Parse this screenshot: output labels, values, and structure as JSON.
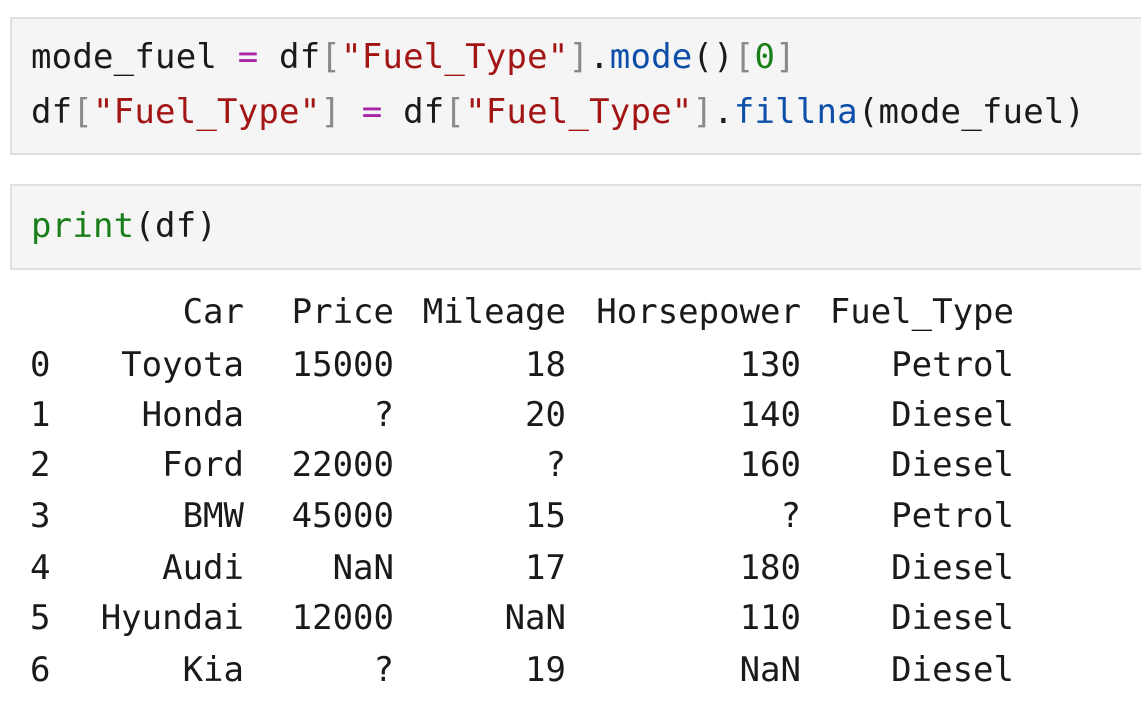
{
  "cells": [
    {
      "lines": [
        [
          {
            "t": "mode_fuel ",
            "c": "plain"
          },
          {
            "t": "=",
            "c": "op"
          },
          {
            "t": " df",
            "c": "plain"
          },
          {
            "t": "[",
            "c": "br"
          },
          {
            "t": "\"Fuel_Type\"",
            "c": "str"
          },
          {
            "t": "]",
            "c": "br"
          },
          {
            "t": ".",
            "c": "plain"
          },
          {
            "t": "mode",
            "c": "fn"
          },
          {
            "t": "()",
            "c": "plain"
          },
          {
            "t": "[",
            "c": "br"
          },
          {
            "t": "0",
            "c": "num"
          },
          {
            "t": "]",
            "c": "br"
          }
        ],
        [
          {
            "t": "df",
            "c": "plain"
          },
          {
            "t": "[",
            "c": "br"
          },
          {
            "t": "\"Fuel_Type\"",
            "c": "str"
          },
          {
            "t": "]",
            "c": "br"
          },
          {
            "t": " ",
            "c": "plain"
          },
          {
            "t": "=",
            "c": "op"
          },
          {
            "t": " df",
            "c": "plain"
          },
          {
            "t": "[",
            "c": "br"
          },
          {
            "t": "\"Fuel_Type\"",
            "c": "str"
          },
          {
            "t": "]",
            "c": "br"
          },
          {
            "t": ".",
            "c": "plain"
          },
          {
            "t": "fillna",
            "c": "fn"
          },
          {
            "t": "(mode_fuel)",
            "c": "plain"
          }
        ]
      ]
    },
    {
      "lines": [
        [
          {
            "t": "print",
            "c": "builtin"
          },
          {
            "t": "(df)",
            "c": "plain"
          }
        ]
      ]
    }
  ],
  "output": {
    "headers": [
      "Car",
      "Price",
      "Mileage",
      "Horsepower",
      "Fuel_Type"
    ],
    "rows": [
      [
        "0",
        "Toyota",
        "15000",
        "18",
        "130",
        "Petrol"
      ],
      [
        "1",
        "Honda",
        "?",
        "20",
        "140",
        "Diesel"
      ],
      [
        "2",
        "Ford",
        "22000",
        "?",
        "160",
        "Diesel"
      ],
      [
        "3",
        "BMW",
        "45000",
        "15",
        "?",
        "Petrol"
      ],
      [
        "4",
        "Audi",
        "NaN",
        "17",
        "180",
        "Diesel"
      ],
      [
        "5",
        "Hyundai",
        "12000",
        "NaN",
        "110",
        "Diesel"
      ],
      [
        "6",
        "Kia",
        "?",
        "19",
        "NaN",
        "Diesel"
      ]
    ]
  }
}
